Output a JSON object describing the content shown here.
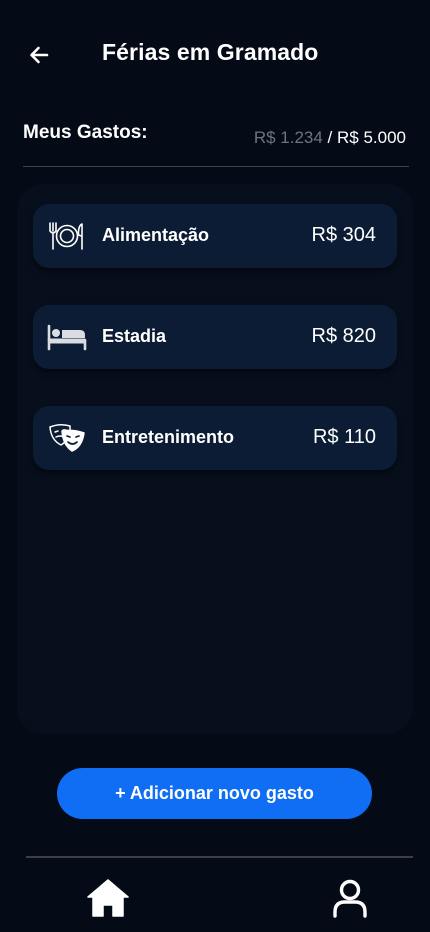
{
  "header": {
    "title": "Férias em Gramado",
    "back_icon": "arrow-left-icon"
  },
  "summary": {
    "label": "Meus Gastos:",
    "spent": "R$ 1.234",
    "separator": " / ",
    "budget": "R$ 5.000"
  },
  "expenses": [
    {
      "label": "Alimentação",
      "amount": "R$ 304",
      "icon": "plate-cutlery-icon"
    },
    {
      "label": "Estadia",
      "amount": "R$ 820",
      "icon": "bed-icon"
    },
    {
      "label": "Entretenimento",
      "amount": "R$ 110",
      "icon": "theater-masks-icon"
    }
  ],
  "actions": {
    "add_label": "+ Adicionar novo gasto"
  },
  "nav": {
    "home_icon": "home-icon",
    "profile_icon": "profile-icon"
  },
  "colors": {
    "background": "#040b16",
    "panel": "#070f1c",
    "card": "#0c1c34",
    "accent": "#0f6ef4",
    "muted_text": "#6d7480"
  }
}
